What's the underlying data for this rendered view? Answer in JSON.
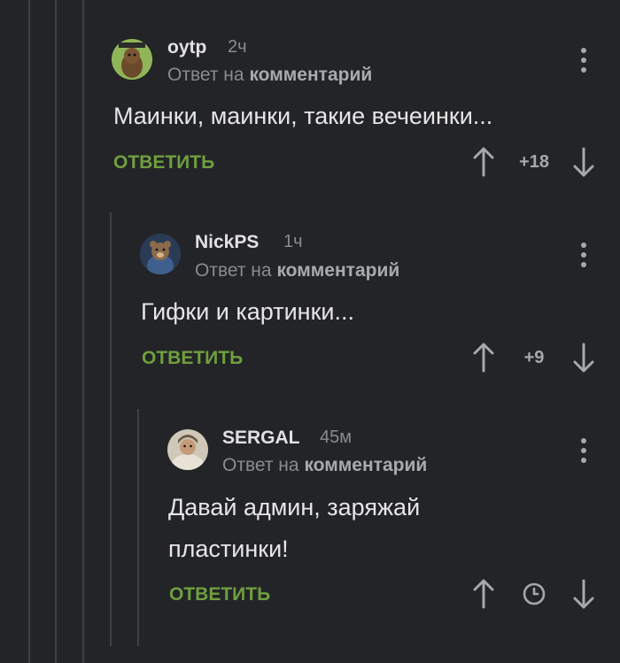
{
  "comments": [
    {
      "username": "oytp",
      "time": "2ч",
      "reply_prefix": "Ответ на",
      "reply_link": "комментарий",
      "text": "Маинки, маинки, такие вечеинки...",
      "reply_label": "ОТВЕТИТЬ",
      "rating": "+18",
      "avatar_icon": "beaver-avatar-icon"
    },
    {
      "username": "NickPS",
      "time": "1ч",
      "reply_prefix": "Ответ на",
      "reply_link": "комментарий",
      "text": "Гифки и картинки...",
      "reply_label": "ОТВЕТИТЬ",
      "rating": "+9",
      "avatar_icon": "bear-avatar-icon"
    },
    {
      "username": "SERGAL",
      "time": "45м",
      "reply_prefix": "Ответ на",
      "reply_link": "комментарий",
      "text_line1": "Давай админ, заряжай",
      "text_line2": "пластинки!",
      "reply_label": "ОТВЕТИТЬ",
      "rating_icon": "clock-icon",
      "avatar_icon": "person-avatar-icon"
    }
  ],
  "colors": {
    "background": "#232427",
    "reply_green": "#6f9f3f",
    "thread_line": "#3f4044"
  }
}
